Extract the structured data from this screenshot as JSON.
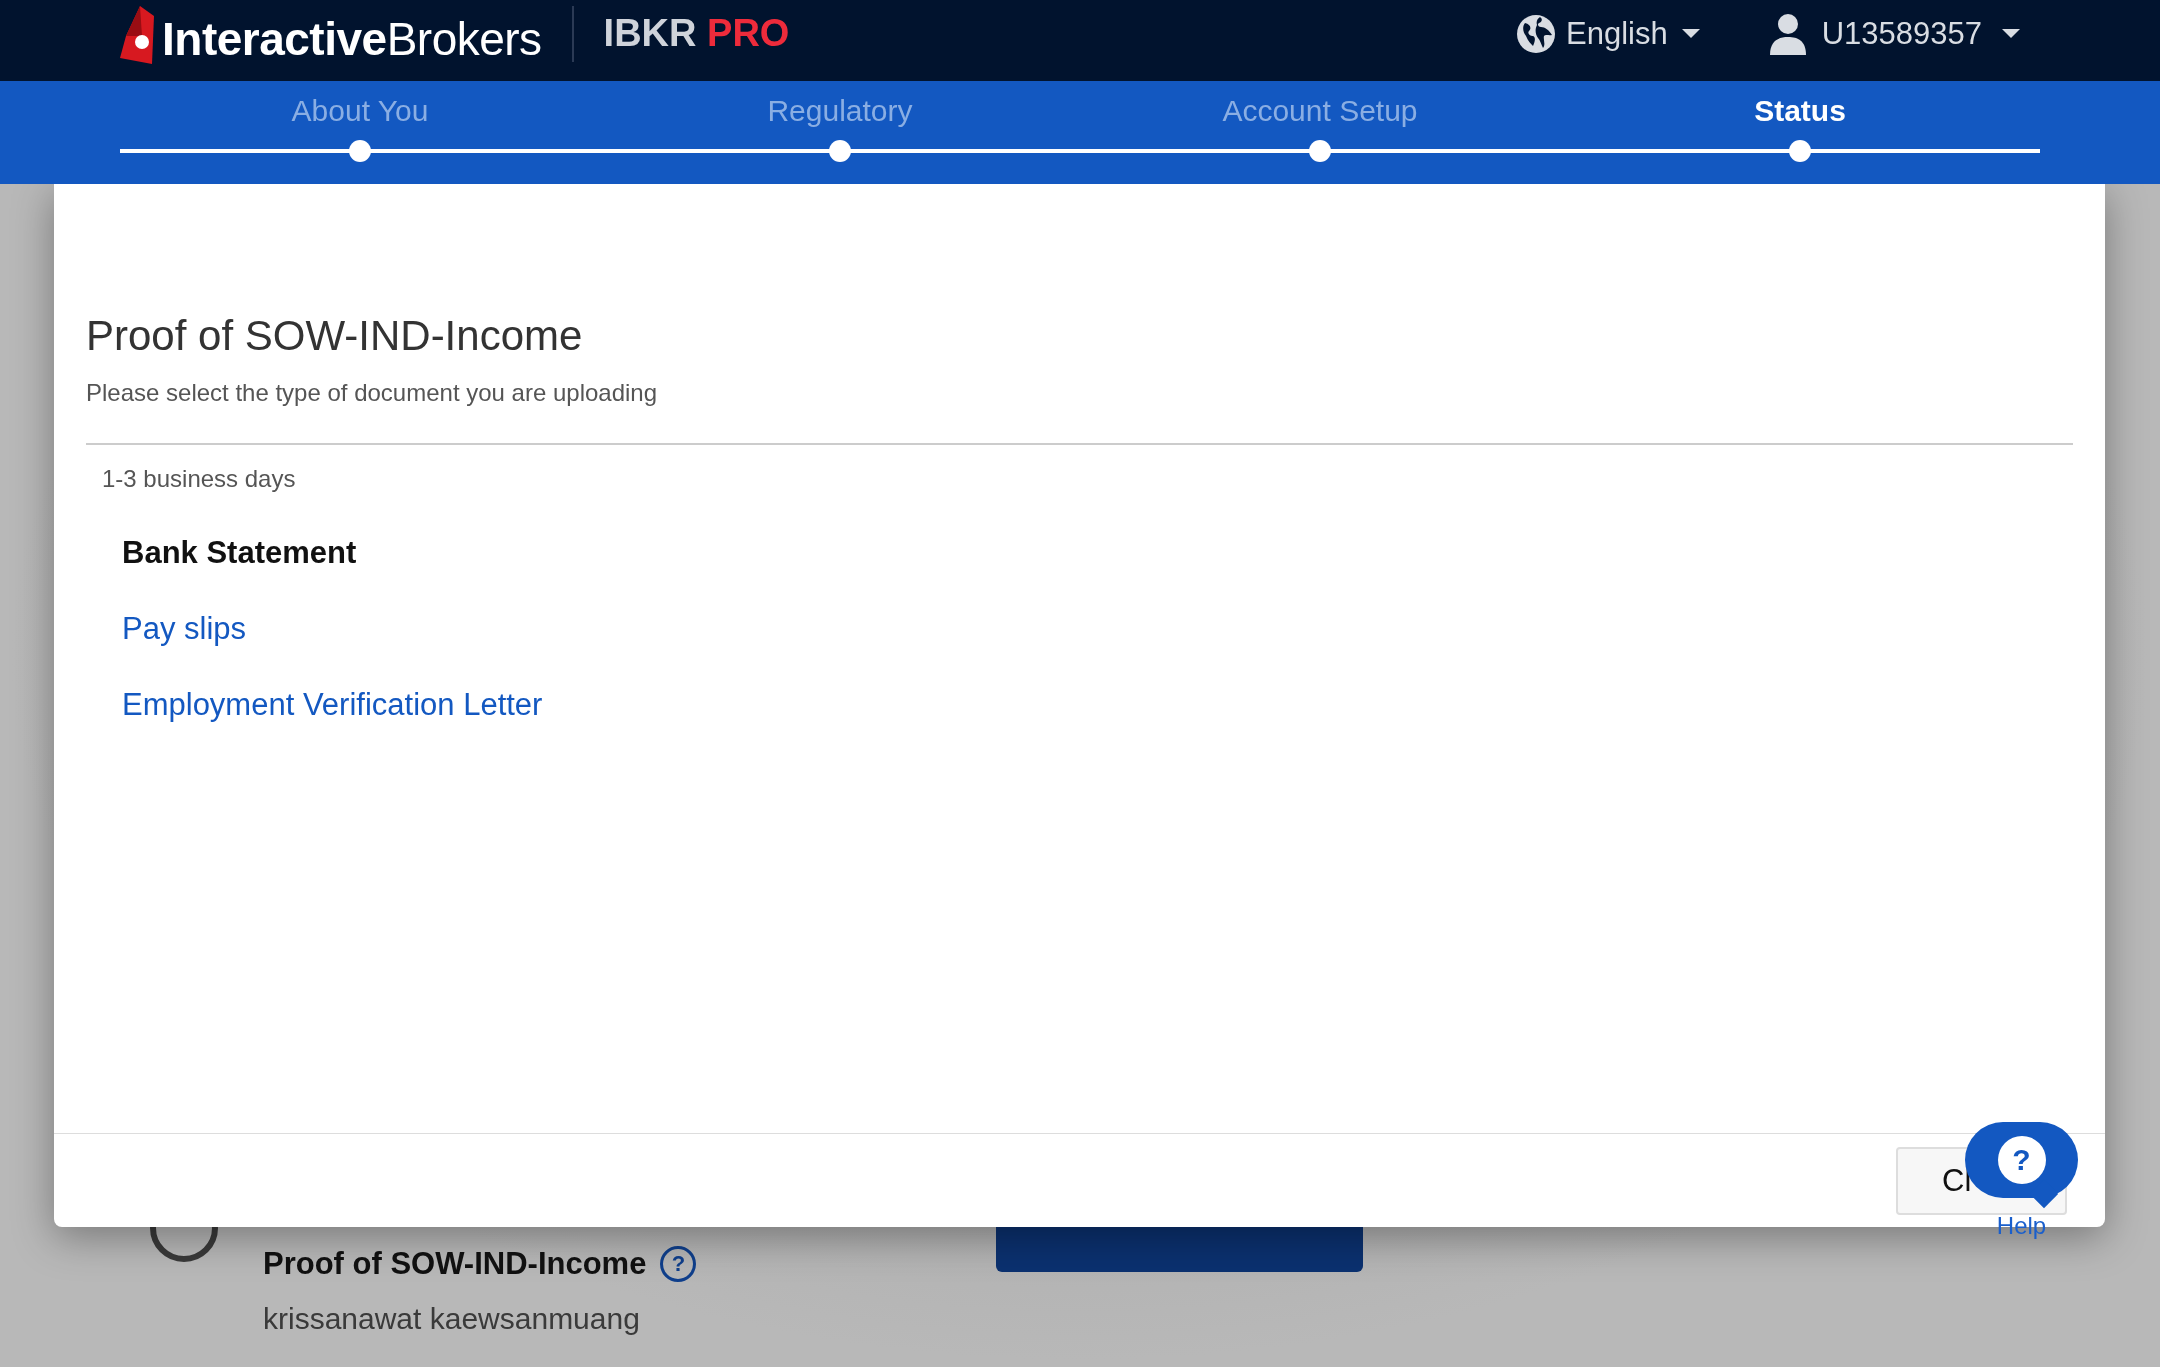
{
  "header": {
    "brand_bold": "Interactive",
    "brand_light": "Brokers",
    "product": "IBKR",
    "product_suffix": "PRO",
    "language": "English",
    "account": "U13589357"
  },
  "steps": [
    {
      "label": "About You",
      "selected": false
    },
    {
      "label": "Regulatory",
      "selected": false
    },
    {
      "label": "Account Setup",
      "selected": false
    },
    {
      "label": "Status",
      "selected": true
    }
  ],
  "background": {
    "document_title": "Proof of SOW-IND-Income",
    "info_icon": "?",
    "owner": "krissanawat kaewsanmuang"
  },
  "modal": {
    "title": "Proof of SOW-IND-Income",
    "subtitle": "Please select the type of document you are uploading",
    "turnaround": "1-3 business days",
    "document_types": [
      {
        "label": "Bank Statement",
        "selected": true
      },
      {
        "label": "Pay slips",
        "selected": false
      },
      {
        "label": "Employment Verification Letter",
        "selected": false
      }
    ],
    "close_button": "Cl"
  },
  "help": {
    "icon": "?",
    "label": "Help"
  }
}
